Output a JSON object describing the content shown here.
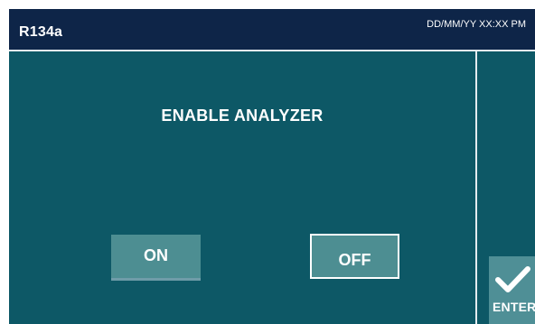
{
  "header": {
    "title": "R134a",
    "datetime": "DD/MM/YY XX:XX PM"
  },
  "main": {
    "prompt": "ENABLE ANALYZER",
    "buttons": {
      "on_label": "ON",
      "off_label": "OFF"
    }
  },
  "sidebar": {
    "enter_label": "ENTER",
    "enter_icon": "checkmark-icon"
  },
  "colors": {
    "background": "#0d5866",
    "header": "#0e2548",
    "button": "#4d8e92",
    "text": "#ffffff"
  }
}
